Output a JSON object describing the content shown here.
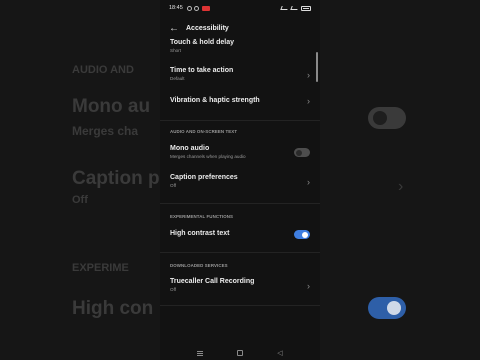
{
  "status_bar": {
    "time": "18:45"
  },
  "app_bar": {
    "title": "Accessibility"
  },
  "rows": {
    "touch_hold": {
      "title": "Touch & hold delay",
      "value": "Short"
    },
    "time_action": {
      "title": "Time to take action",
      "value": "Default"
    },
    "vibration": {
      "title": "Vibration & haptic strength"
    },
    "mono_audio": {
      "title": "Mono audio",
      "subtitle": "Merges channels when playing audio",
      "enabled": false
    },
    "caption": {
      "title": "Caption preferences",
      "value": "Off"
    },
    "high_contrast": {
      "title": "High contrast text",
      "enabled": true
    },
    "truecaller": {
      "title": "Truecaller Call Recording",
      "value": "Off"
    }
  },
  "sections": {
    "audio": "AUDIO AND ON-SCREEN TEXT",
    "experimental": "EXPERIMENTAL FUNCTIONS",
    "downloaded": "DOWNLOADED SERVICES"
  },
  "background": {
    "audio_header": "AUDIO AND",
    "mono": "Mono au",
    "merges": "Merges cha",
    "caption": "Caption p",
    "off": "Off",
    "experimental": "EXPERIME",
    "high_contrast": "High con"
  },
  "colors": {
    "accent": "#3f7ee0",
    "background": "#121212",
    "toggle_off": "#4d4d4d"
  },
  "icons": [
    "back-arrow-icon",
    "chevron-right-icon",
    "menu-icon",
    "home-icon",
    "back-triangle-icon"
  ]
}
